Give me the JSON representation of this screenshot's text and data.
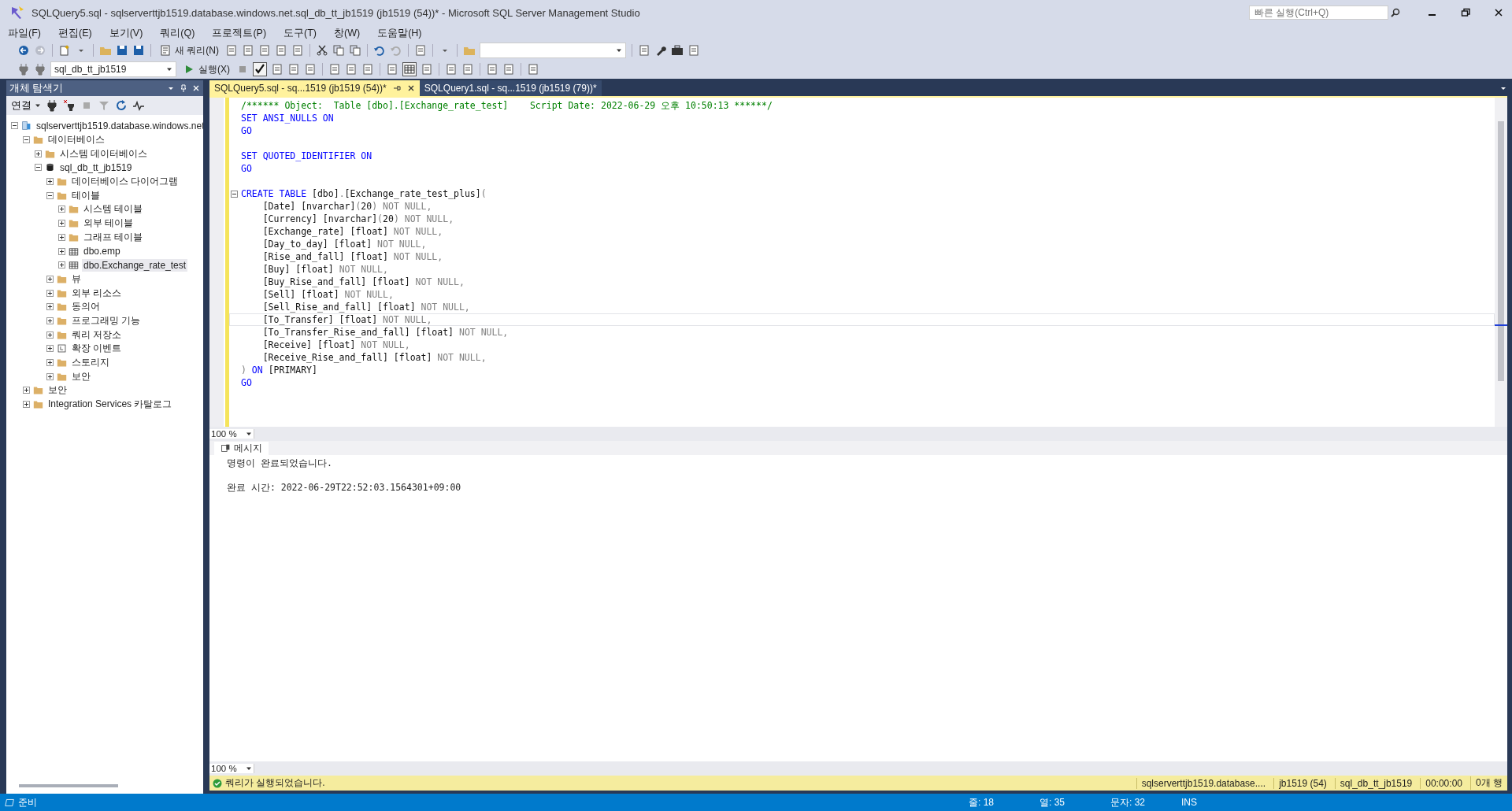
{
  "window": {
    "title": "SQLQuery5.sql - sqlserverttjb1519.database.windows.net.sql_db_tt_jb1519 (jb1519 (54))* - Microsoft SQL Server Management Studio",
    "quick_launch": {
      "placeholder": "빠른 실행(Ctrl+Q)"
    }
  },
  "menu": [
    "파일(F)",
    "편집(E)",
    "보기(V)",
    "쿼리(Q)",
    "프로젝트(P)",
    "도구(T)",
    "창(W)",
    "도움말(H)"
  ],
  "toolbar": {
    "new_query": "새 쿼리(N)",
    "execute": "실행(X)",
    "database": "sql_db_tt_jb1519"
  },
  "object_explorer": {
    "title": "개체 탐색기",
    "connect": "연결",
    "tree": [
      {
        "label": "sqlserverttjb1519.database.windows.net",
        "kind": "server",
        "expanded": true,
        "selected": false,
        "children": [
          {
            "label": "데이터베이스",
            "kind": "folder",
            "expanded": true,
            "selected": false,
            "children": [
              {
                "label": "시스템 데이터베이스",
                "kind": "folder",
                "expanded": false,
                "selected": false
              },
              {
                "label": "sql_db_tt_jb1519",
                "kind": "database",
                "expanded": true,
                "selected": false,
                "children": [
                  {
                    "label": "데이터베이스 다이어그램",
                    "kind": "folder",
                    "expanded": false,
                    "selected": false
                  },
                  {
                    "label": "테이블",
                    "kind": "folder",
                    "expanded": true,
                    "selected": false,
                    "children": [
                      {
                        "label": "시스템 테이블",
                        "kind": "folder",
                        "expanded": false,
                        "selected": false
                      },
                      {
                        "label": "외부 테이블",
                        "kind": "folder",
                        "expanded": false,
                        "selected": false
                      },
                      {
                        "label": "그래프 테이블",
                        "kind": "folder",
                        "expanded": false,
                        "selected": false
                      },
                      {
                        "label": "dbo.emp",
                        "kind": "table",
                        "expanded": false,
                        "selected": false
                      },
                      {
                        "label": "dbo.Exchange_rate_test",
                        "kind": "table",
                        "expanded": false,
                        "selected": true
                      }
                    ]
                  },
                  {
                    "label": "뷰",
                    "kind": "folder",
                    "expanded": false,
                    "selected": false
                  },
                  {
                    "label": "외부 리소스",
                    "kind": "folder",
                    "expanded": false,
                    "selected": false
                  },
                  {
                    "label": "동의어",
                    "kind": "folder",
                    "expanded": false,
                    "selected": false
                  },
                  {
                    "label": "프로그래밍 기능",
                    "kind": "folder",
                    "expanded": false,
                    "selected": false
                  },
                  {
                    "label": "쿼리 저장소",
                    "kind": "folder",
                    "expanded": false,
                    "selected": false
                  },
                  {
                    "label": "확장 이벤트",
                    "kind": "event",
                    "expanded": false,
                    "selected": false
                  },
                  {
                    "label": "스토리지",
                    "kind": "folder",
                    "expanded": false,
                    "selected": false
                  },
                  {
                    "label": "보안",
                    "kind": "folder",
                    "expanded": false,
                    "selected": false
                  }
                ]
              }
            ]
          },
          {
            "label": "보안",
            "kind": "folder",
            "expanded": false,
            "selected": false
          },
          {
            "label": "Integration Services 카탈로그",
            "kind": "folder",
            "expanded": false,
            "selected": false
          }
        ]
      }
    ]
  },
  "tabs": [
    {
      "label": "SQLQuery5.sql - sq...1519 (jb1519 (54))*",
      "selected": true
    },
    {
      "label": "SQLQuery1.sql - sq...1519 (jb1519 (79))*",
      "selected": false
    }
  ],
  "editor": {
    "zoom": "100 %",
    "lines": [
      {
        "fold": false,
        "current": false,
        "tokens": [
          {
            "kind": "comment",
            "text": "/****** Object:  Table [dbo].[Exchange_rate_test]    Script Date: 2022-06-29 오후 10:50:13 ******/"
          }
        ]
      },
      {
        "fold": false,
        "current": false,
        "tokens": [
          {
            "kind": "keyword",
            "text": "SET ANSI_NULLS ON"
          }
        ]
      },
      {
        "fold": false,
        "current": false,
        "tokens": [
          {
            "kind": "keyword",
            "text": "GO"
          }
        ]
      },
      {
        "fold": false,
        "current": false
      },
      {
        "fold": false,
        "current": false,
        "tokens": [
          {
            "kind": "keyword",
            "text": "SET QUOTED_IDENTIFIER ON"
          }
        ]
      },
      {
        "fold": false,
        "current": false,
        "tokens": [
          {
            "kind": "keyword",
            "text": "GO"
          }
        ]
      },
      {
        "fold": false,
        "current": false
      },
      {
        "fold": true,
        "current": false,
        "tokens": [
          {
            "kind": "keyword",
            "text": "CREATE TABLE"
          },
          {
            "kind": "plain",
            "text": " [dbo]"
          },
          {
            "kind": "gray",
            "text": "."
          },
          {
            "kind": "plain",
            "text": "[Exchange_rate_test_plus]"
          },
          {
            "kind": "gray",
            "text": "("
          }
        ]
      },
      {
        "fold": false,
        "current": false,
        "tokens": [
          {
            "kind": "plain",
            "text": "    [Date] [nvarchar]"
          },
          {
            "kind": "gray",
            "text": "("
          },
          {
            "kind": "plain",
            "text": "20"
          },
          {
            "kind": "gray",
            "text": ") NOT NULL,"
          }
        ]
      },
      {
        "fold": false,
        "current": false,
        "tokens": [
          {
            "kind": "plain",
            "text": "    [Currency] [nvarchar]"
          },
          {
            "kind": "gray",
            "text": "("
          },
          {
            "kind": "plain",
            "text": "20"
          },
          {
            "kind": "gray",
            "text": ") NOT NULL,"
          }
        ]
      },
      {
        "fold": false,
        "current": false,
        "tokens": [
          {
            "kind": "plain",
            "text": "    [Exchange_rate] [float]"
          },
          {
            "kind": "gray",
            "text": " NOT NULL,"
          }
        ]
      },
      {
        "fold": false,
        "current": false,
        "tokens": [
          {
            "kind": "plain",
            "text": "    [Day_to_day] [float]"
          },
          {
            "kind": "gray",
            "text": " NOT NULL,"
          }
        ]
      },
      {
        "fold": false,
        "current": false,
        "tokens": [
          {
            "kind": "plain",
            "text": "    [Rise_and_fall] [float]"
          },
          {
            "kind": "gray",
            "text": " NOT NULL,"
          }
        ]
      },
      {
        "fold": false,
        "current": false,
        "tokens": [
          {
            "kind": "plain",
            "text": "    [Buy] [float]"
          },
          {
            "kind": "gray",
            "text": " NOT NULL,"
          }
        ]
      },
      {
        "fold": false,
        "current": false,
        "tokens": [
          {
            "kind": "plain",
            "text": "    [Buy_Rise_and_fall] [float]"
          },
          {
            "kind": "gray",
            "text": " NOT NULL,"
          }
        ]
      },
      {
        "fold": false,
        "current": false,
        "tokens": [
          {
            "kind": "plain",
            "text": "    [Sell] [float]"
          },
          {
            "kind": "gray",
            "text": " NOT NULL,"
          }
        ]
      },
      {
        "fold": false,
        "current": false,
        "tokens": [
          {
            "kind": "plain",
            "text": "    [Sell_Rise_and_fall] [float]"
          },
          {
            "kind": "gray",
            "text": " NOT NULL,"
          }
        ]
      },
      {
        "fold": false,
        "current": true,
        "tokens": [
          {
            "kind": "plain",
            "text": "    [To_Transfer] [float]"
          },
          {
            "kind": "gray",
            "text": " NOT NULL,"
          }
        ]
      },
      {
        "fold": false,
        "current": false,
        "tokens": [
          {
            "kind": "plain",
            "text": "    [To_Transfer_Rise_and_fall] [float]"
          },
          {
            "kind": "gray",
            "text": " NOT NULL,"
          }
        ]
      },
      {
        "fold": false,
        "current": false,
        "tokens": [
          {
            "kind": "plain",
            "text": "    [Receive] [float]"
          },
          {
            "kind": "gray",
            "text": " NOT NULL,"
          }
        ]
      },
      {
        "fold": false,
        "current": false,
        "tokens": [
          {
            "kind": "plain",
            "text": "    [Receive_Rise_and_fall] [float]"
          },
          {
            "kind": "gray",
            "text": " NOT NULL,"
          }
        ]
      },
      {
        "fold": false,
        "current": false,
        "tokens": [
          {
            "kind": "gray",
            "text": ")"
          },
          {
            "kind": "keyword",
            "text": " ON"
          },
          {
            "kind": "plain",
            "text": " [PRIMARY]"
          }
        ]
      },
      {
        "fold": false,
        "current": false,
        "tokens": [
          {
            "kind": "keyword",
            "text": "GO"
          }
        ]
      }
    ]
  },
  "results": {
    "tab": "메시지",
    "zoom": "100 %",
    "messages": [
      "명령이 완료되었습니다.",
      "완료 시간: 2022-06-29T22:52:03.1564301+09:00"
    ]
  },
  "query_status": {
    "text": "쿼리가 실행되었습니다.",
    "fields": [
      "sqlserverttjb1519.database....",
      "jb1519 (54)",
      "sql_db_tt_jb1519",
      "00:00:00",
      "0개 행"
    ]
  },
  "status_bar": {
    "state": "준비",
    "fields": [
      "줄: 18",
      "열: 35",
      "문자: 32",
      "INS"
    ]
  }
}
